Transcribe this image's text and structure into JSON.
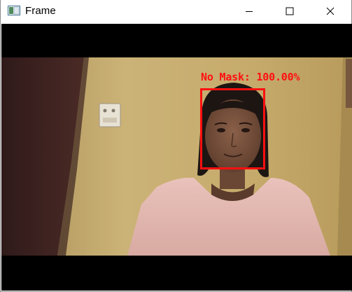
{
  "window": {
    "title": "Frame",
    "controls": {
      "minimize_icon": "minimize-icon",
      "maximize_icon": "maximize-icon",
      "close_icon": "close-icon"
    }
  },
  "video": {
    "detection": {
      "label": "No Mask: 100.00%",
      "box_color": "#ff1010"
    }
  },
  "colors": {
    "letterbox": "#000000",
    "wall": "#c7ad6e",
    "overlay": "#ff1010"
  }
}
